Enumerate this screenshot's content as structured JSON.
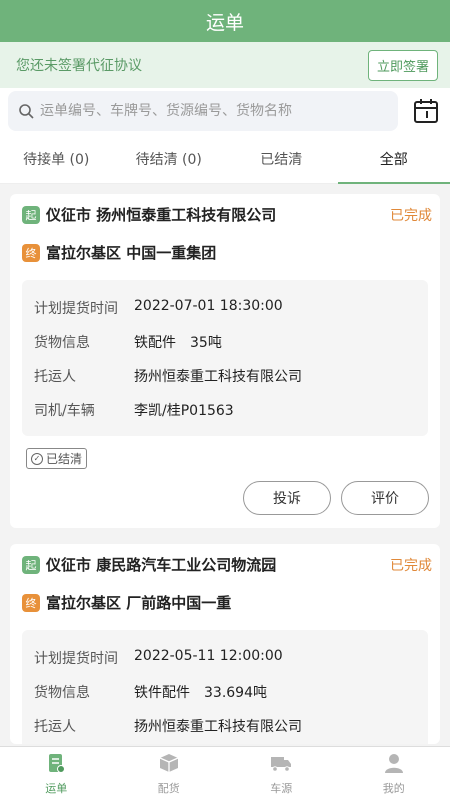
{
  "header": {
    "title": "运单"
  },
  "notice": {
    "text": "您还未签署代征协议",
    "button": "立即签署"
  },
  "search": {
    "placeholder": "运单编号、车牌号、货源编号、货物名称"
  },
  "tabs": [
    {
      "label": "待接单 (0)"
    },
    {
      "label": "待结清 (0)"
    },
    {
      "label": "已结清"
    },
    {
      "label": "全部"
    }
  ],
  "orders": [
    {
      "start_tag": "起",
      "start": "仪征市 扬州恒泰重工科技有限公司",
      "end_tag": "终",
      "end": "富拉尔基区 中国一重集团",
      "status": "已完成",
      "rows": [
        {
          "label": "计划提货时间",
          "value": "2022-07-01 18:30:00"
        },
        {
          "label": "货物信息",
          "value": "铁配件　35吨"
        },
        {
          "label": "托运人",
          "value": "扬州恒泰重工科技有限公司"
        },
        {
          "label": "司机/车辆",
          "value": "李凯/桂P01563"
        }
      ],
      "badge": "已结清",
      "buttons": {
        "complain": "投诉",
        "review": "评价"
      }
    },
    {
      "start_tag": "起",
      "start": "仪征市 康民路汽车工业公司物流园",
      "end_tag": "终",
      "end": "富拉尔基区 厂前路中国一重",
      "status": "已完成",
      "rows": [
        {
          "label": "计划提货时间",
          "value": "2022-05-11 12:00:00"
        },
        {
          "label": "货物信息",
          "value": "铁件配件　33.694吨"
        },
        {
          "label": "托运人",
          "value": "扬州恒泰重工科技有限公司"
        }
      ]
    }
  ],
  "bottom_nav": [
    {
      "label": "运单",
      "icon": "waybill-icon"
    },
    {
      "label": "配货",
      "icon": "box-icon"
    },
    {
      "label": "车源",
      "icon": "truck-icon"
    },
    {
      "label": "我的",
      "icon": "user-icon"
    }
  ],
  "colors": {
    "primary": "#6fb37b",
    "accent": "#e0893a"
  }
}
